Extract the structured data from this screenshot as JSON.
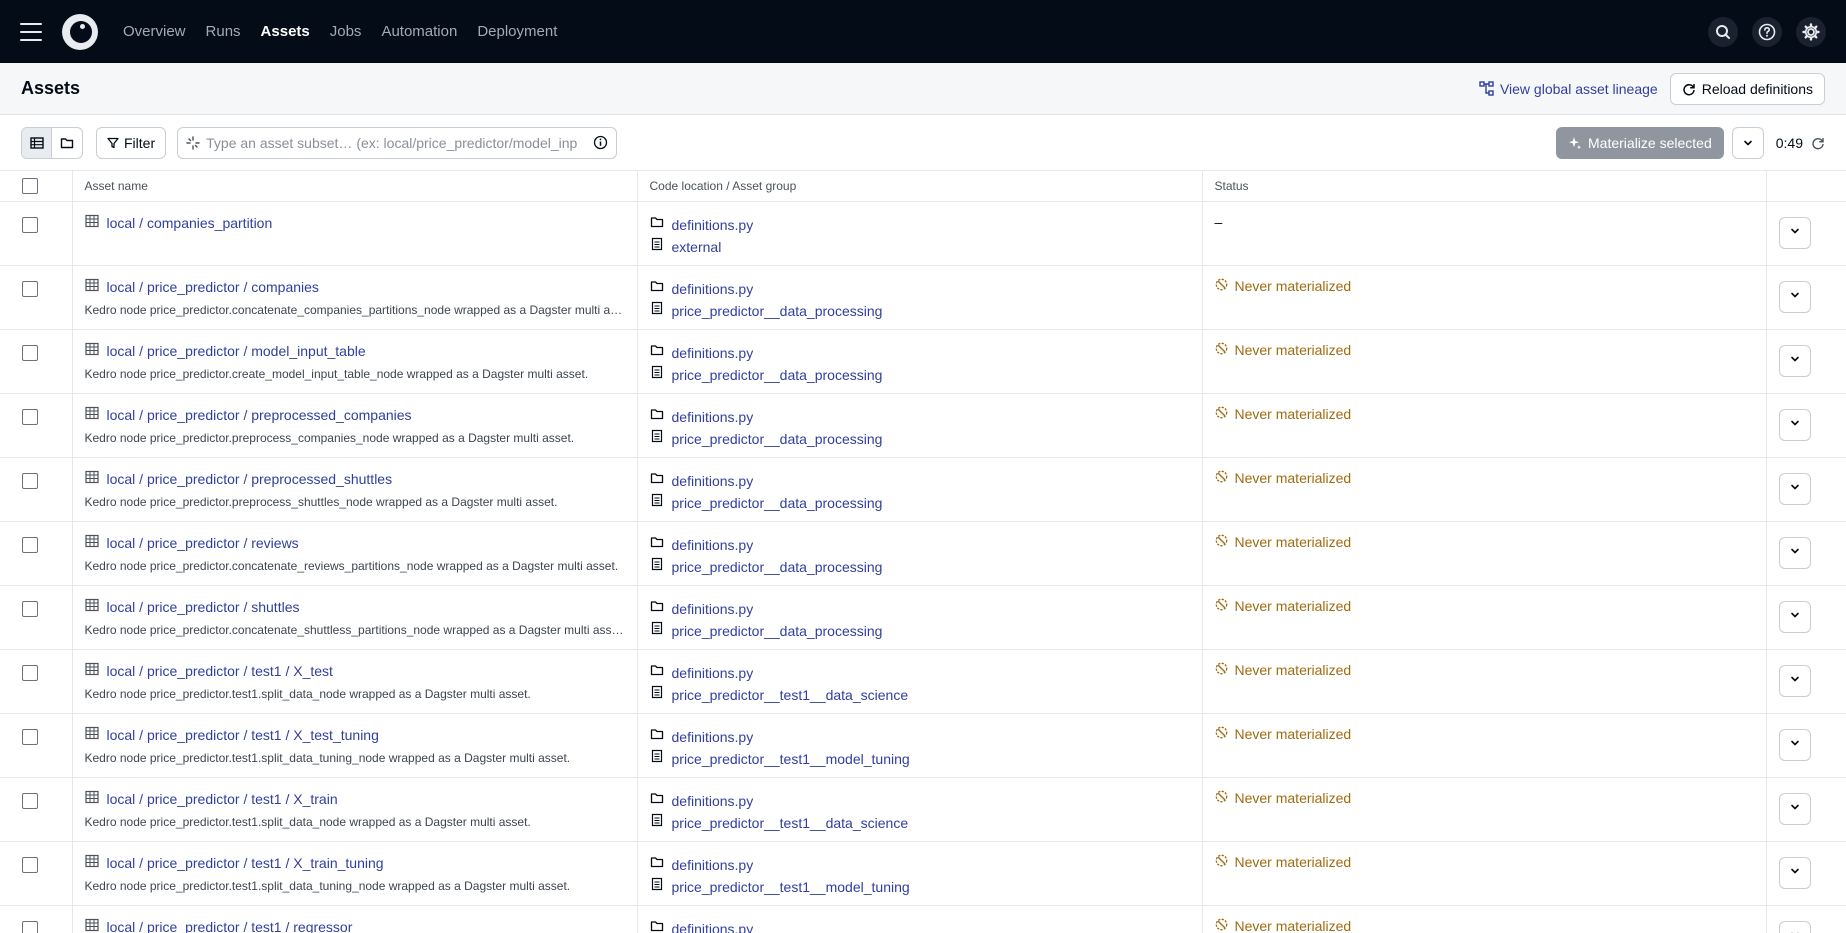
{
  "nav": {
    "links": [
      "Overview",
      "Runs",
      "Assets",
      "Jobs",
      "Automation",
      "Deployment"
    ],
    "active": "Assets"
  },
  "header": {
    "title": "Assets",
    "lineage_label": "View global asset lineage",
    "reload_label": "Reload definitions"
  },
  "toolbar": {
    "filter_label": "Filter",
    "search_placeholder": "Type an asset subset… (ex: local/price_predictor/model_inp",
    "materialize_label": "Materialize selected",
    "timer": "0:49"
  },
  "table": {
    "headers": [
      "Asset name",
      "Code location / Asset group",
      "Status"
    ],
    "rows": [
      {
        "name": "local / companies_partition",
        "desc": "",
        "location": "definitions.py",
        "group": "external",
        "status": "–"
      },
      {
        "name": "local / price_predictor / companies",
        "desc": "Kedro node price_predictor.concatenate_companies_partitions_node wrapped as a Dagster multi asset.",
        "location": "definitions.py",
        "group": "price_predictor__data_processing",
        "status": "Never materialized"
      },
      {
        "name": "local / price_predictor / model_input_table",
        "desc": "Kedro node price_predictor.create_model_input_table_node wrapped as a Dagster multi asset.",
        "location": "definitions.py",
        "group": "price_predictor__data_processing",
        "status": "Never materialized"
      },
      {
        "name": "local / price_predictor / preprocessed_companies",
        "desc": "Kedro node price_predictor.preprocess_companies_node wrapped as a Dagster multi asset.",
        "location": "definitions.py",
        "group": "price_predictor__data_processing",
        "status": "Never materialized"
      },
      {
        "name": "local / price_predictor / preprocessed_shuttles",
        "desc": "Kedro node price_predictor.preprocess_shuttles_node wrapped as a Dagster multi asset.",
        "location": "definitions.py",
        "group": "price_predictor__data_processing",
        "status": "Never materialized"
      },
      {
        "name": "local / price_predictor / reviews",
        "desc": "Kedro node price_predictor.concatenate_reviews_partitions_node wrapped as a Dagster multi asset.",
        "location": "definitions.py",
        "group": "price_predictor__data_processing",
        "status": "Never materialized"
      },
      {
        "name": "local / price_predictor / shuttles",
        "desc": "Kedro node price_predictor.concatenate_shuttless_partitions_node wrapped as a Dagster multi asset.",
        "location": "definitions.py",
        "group": "price_predictor__data_processing",
        "status": "Never materialized"
      },
      {
        "name": "local / price_predictor / test1 / X_test",
        "desc": "Kedro node price_predictor.test1.split_data_node wrapped as a Dagster multi asset.",
        "location": "definitions.py",
        "group": "price_predictor__test1__data_science",
        "status": "Never materialized"
      },
      {
        "name": "local / price_predictor / test1 / X_test_tuning",
        "desc": "Kedro node price_predictor.test1.split_data_tuning_node wrapped as a Dagster multi asset.",
        "location": "definitions.py",
        "group": "price_predictor__test1__model_tuning",
        "status": "Never materialized"
      },
      {
        "name": "local / price_predictor / test1 / X_train",
        "desc": "Kedro node price_predictor.test1.split_data_node wrapped as a Dagster multi asset.",
        "location": "definitions.py",
        "group": "price_predictor__test1__data_science",
        "status": "Never materialized"
      },
      {
        "name": "local / price_predictor / test1 / X_train_tuning",
        "desc": "Kedro node price_predictor.test1.split_data_tuning_node wrapped as a Dagster multi asset.",
        "location": "definitions.py",
        "group": "price_predictor__test1__model_tuning",
        "status": "Never materialized"
      },
      {
        "name": "local / price_predictor / test1 / regressor",
        "desc": "",
        "location": "definitions.py",
        "group": "",
        "status": "Never materialized"
      }
    ]
  },
  "colors": {
    "nav_bg": "#030c17",
    "link": "#303f9f",
    "warning": "#a06b0f"
  }
}
